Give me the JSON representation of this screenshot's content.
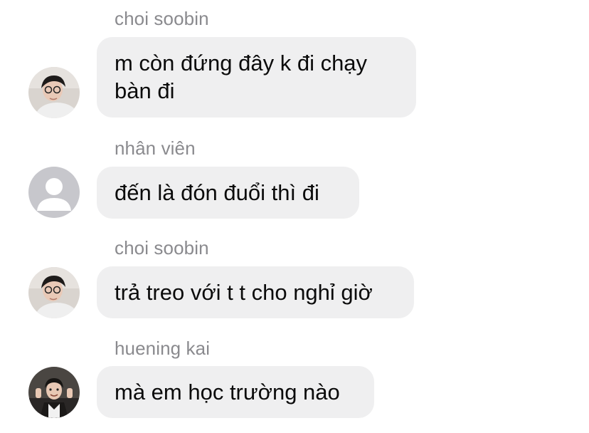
{
  "messages": [
    {
      "sender": "choi soobin",
      "text": "m còn đứng đây k đi chạy bàn đi",
      "avatar": "photo-avatar-soobin-icon"
    },
    {
      "sender": "nhân viên",
      "text": "đến là đón đuổi thì đi",
      "avatar": "default-user-avatar-icon"
    },
    {
      "sender": "choi soobin",
      "text": "trả treo với t t cho nghỉ giờ",
      "avatar": "photo-avatar-soobin-icon"
    },
    {
      "sender": "huening kai",
      "text": "mà em học trường nào",
      "avatar": "photo-avatar-huening-kai-icon"
    }
  ],
  "colors": {
    "bubble_bg": "#efeff0",
    "sender_text": "#8a8a8e",
    "message_text": "#0b0b0b",
    "default_avatar_bg": "#c7c7cc"
  }
}
